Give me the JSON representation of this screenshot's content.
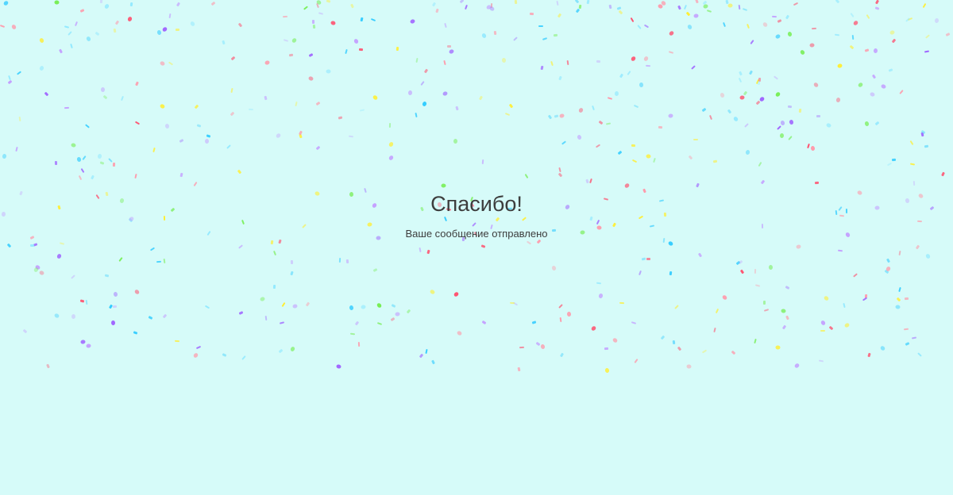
{
  "page": {
    "title": "Спасибо!",
    "subtitle": "Ваше сообщение отправлено"
  },
  "colors": {
    "background": "#d6fbf9",
    "text": "#3d3d3d",
    "confetti": [
      "#ff4f6d",
      "#a066ff",
      "#33ccff",
      "#ffee33",
      "#77ee55",
      "#ff99aa",
      "#c4a0ff",
      "#8fe8ff"
    ]
  },
  "decoration": {
    "type": "confetti"
  }
}
